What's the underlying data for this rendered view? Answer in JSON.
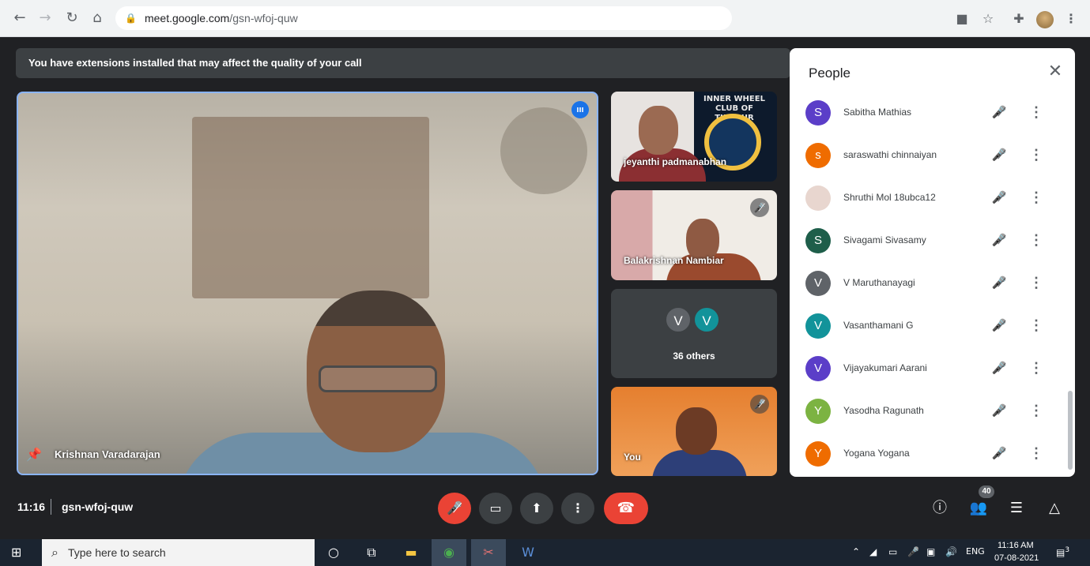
{
  "browser": {
    "url_host": "meet.google.com",
    "url_path": "/gsn-wfoj-quw"
  },
  "banner": {
    "text": "You have extensions installed that may affect the quality of your call"
  },
  "main_video": {
    "participant_name": "Krishnan Varadarajan"
  },
  "tiles": {
    "tile1": {
      "name": "jeyanthi padmanabhan",
      "club_text": "INNER WHEEL CLUB OF TIRUPUR"
    },
    "tile2": {
      "name": "Balakrishnan Nambiar"
    },
    "tile3": {
      "avatar1": "V",
      "avatar2": "V",
      "others": "36 others"
    },
    "tile4": {
      "name": "You"
    }
  },
  "people_panel": {
    "title": "People",
    "participants": [
      {
        "initial": "S",
        "name": "Sabitha Mathias",
        "color": "#5b3ec8"
      },
      {
        "initial": "s",
        "name": "saraswathi chinnaiyan",
        "color": "#ef6c00"
      },
      {
        "initial": "",
        "name": "Shruthi Mol 18ubca12",
        "color": "#e8d6cf"
      },
      {
        "initial": "S",
        "name": "Sivagami Sivasamy",
        "color": "#1e5e4a"
      },
      {
        "initial": "V",
        "name": "V Maruthanayagi",
        "color": "#5f6368"
      },
      {
        "initial": "V",
        "name": "Vasanthamani G",
        "color": "#12939a"
      },
      {
        "initial": "V",
        "name": "Vijayakumari Aarani",
        "color": "#5b3ec8"
      },
      {
        "initial": "Y",
        "name": "Yasodha Ragunath",
        "color": "#7cb342"
      },
      {
        "initial": "Y",
        "name": "Yogana Yogana",
        "color": "#ef6c00"
      }
    ]
  },
  "bottom_bar": {
    "time": "11:16",
    "meeting_code": "gsn-wfoj-quw",
    "participant_count": "40"
  },
  "taskbar": {
    "search_placeholder": "Type here to search",
    "language": "ENG",
    "clock_time": "11:16 AM",
    "clock_date": "07-08-2021",
    "notification_count": "3"
  }
}
